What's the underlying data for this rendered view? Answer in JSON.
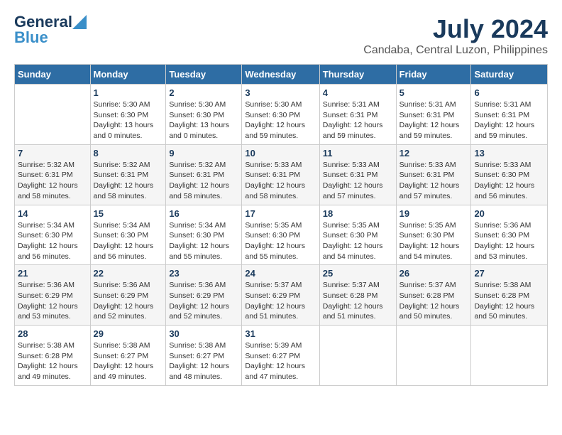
{
  "logo": {
    "line1": "General",
    "line2": "Blue"
  },
  "title": "July 2024",
  "subtitle": "Candaba, Central Luzon, Philippines",
  "days_header": [
    "Sunday",
    "Monday",
    "Tuesday",
    "Wednesday",
    "Thursday",
    "Friday",
    "Saturday"
  ],
  "weeks": [
    [
      {
        "day": "",
        "info": ""
      },
      {
        "day": "1",
        "info": "Sunrise: 5:30 AM\nSunset: 6:30 PM\nDaylight: 13 hours\nand 0 minutes."
      },
      {
        "day": "2",
        "info": "Sunrise: 5:30 AM\nSunset: 6:30 PM\nDaylight: 13 hours\nand 0 minutes."
      },
      {
        "day": "3",
        "info": "Sunrise: 5:30 AM\nSunset: 6:30 PM\nDaylight: 12 hours\nand 59 minutes."
      },
      {
        "day": "4",
        "info": "Sunrise: 5:31 AM\nSunset: 6:31 PM\nDaylight: 12 hours\nand 59 minutes."
      },
      {
        "day": "5",
        "info": "Sunrise: 5:31 AM\nSunset: 6:31 PM\nDaylight: 12 hours\nand 59 minutes."
      },
      {
        "day": "6",
        "info": "Sunrise: 5:31 AM\nSunset: 6:31 PM\nDaylight: 12 hours\nand 59 minutes."
      }
    ],
    [
      {
        "day": "7",
        "info": "Sunrise: 5:32 AM\nSunset: 6:31 PM\nDaylight: 12 hours\nand 58 minutes."
      },
      {
        "day": "8",
        "info": "Sunrise: 5:32 AM\nSunset: 6:31 PM\nDaylight: 12 hours\nand 58 minutes."
      },
      {
        "day": "9",
        "info": "Sunrise: 5:32 AM\nSunset: 6:31 PM\nDaylight: 12 hours\nand 58 minutes."
      },
      {
        "day": "10",
        "info": "Sunrise: 5:33 AM\nSunset: 6:31 PM\nDaylight: 12 hours\nand 58 minutes."
      },
      {
        "day": "11",
        "info": "Sunrise: 5:33 AM\nSunset: 6:31 PM\nDaylight: 12 hours\nand 57 minutes."
      },
      {
        "day": "12",
        "info": "Sunrise: 5:33 AM\nSunset: 6:31 PM\nDaylight: 12 hours\nand 57 minutes."
      },
      {
        "day": "13",
        "info": "Sunrise: 5:33 AM\nSunset: 6:30 PM\nDaylight: 12 hours\nand 56 minutes."
      }
    ],
    [
      {
        "day": "14",
        "info": "Sunrise: 5:34 AM\nSunset: 6:30 PM\nDaylight: 12 hours\nand 56 minutes."
      },
      {
        "day": "15",
        "info": "Sunrise: 5:34 AM\nSunset: 6:30 PM\nDaylight: 12 hours\nand 56 minutes."
      },
      {
        "day": "16",
        "info": "Sunrise: 5:34 AM\nSunset: 6:30 PM\nDaylight: 12 hours\nand 55 minutes."
      },
      {
        "day": "17",
        "info": "Sunrise: 5:35 AM\nSunset: 6:30 PM\nDaylight: 12 hours\nand 55 minutes."
      },
      {
        "day": "18",
        "info": "Sunrise: 5:35 AM\nSunset: 6:30 PM\nDaylight: 12 hours\nand 54 minutes."
      },
      {
        "day": "19",
        "info": "Sunrise: 5:35 AM\nSunset: 6:30 PM\nDaylight: 12 hours\nand 54 minutes."
      },
      {
        "day": "20",
        "info": "Sunrise: 5:36 AM\nSunset: 6:30 PM\nDaylight: 12 hours\nand 53 minutes."
      }
    ],
    [
      {
        "day": "21",
        "info": "Sunrise: 5:36 AM\nSunset: 6:29 PM\nDaylight: 12 hours\nand 53 minutes."
      },
      {
        "day": "22",
        "info": "Sunrise: 5:36 AM\nSunset: 6:29 PM\nDaylight: 12 hours\nand 52 minutes."
      },
      {
        "day": "23",
        "info": "Sunrise: 5:36 AM\nSunset: 6:29 PM\nDaylight: 12 hours\nand 52 minutes."
      },
      {
        "day": "24",
        "info": "Sunrise: 5:37 AM\nSunset: 6:29 PM\nDaylight: 12 hours\nand 51 minutes."
      },
      {
        "day": "25",
        "info": "Sunrise: 5:37 AM\nSunset: 6:28 PM\nDaylight: 12 hours\nand 51 minutes."
      },
      {
        "day": "26",
        "info": "Sunrise: 5:37 AM\nSunset: 6:28 PM\nDaylight: 12 hours\nand 50 minutes."
      },
      {
        "day": "27",
        "info": "Sunrise: 5:38 AM\nSunset: 6:28 PM\nDaylight: 12 hours\nand 50 minutes."
      }
    ],
    [
      {
        "day": "28",
        "info": "Sunrise: 5:38 AM\nSunset: 6:28 PM\nDaylight: 12 hours\nand 49 minutes."
      },
      {
        "day": "29",
        "info": "Sunrise: 5:38 AM\nSunset: 6:27 PM\nDaylight: 12 hours\nand 49 minutes."
      },
      {
        "day": "30",
        "info": "Sunrise: 5:38 AM\nSunset: 6:27 PM\nDaylight: 12 hours\nand 48 minutes."
      },
      {
        "day": "31",
        "info": "Sunrise: 5:39 AM\nSunset: 6:27 PM\nDaylight: 12 hours\nand 47 minutes."
      },
      {
        "day": "",
        "info": ""
      },
      {
        "day": "",
        "info": ""
      },
      {
        "day": "",
        "info": ""
      }
    ]
  ]
}
